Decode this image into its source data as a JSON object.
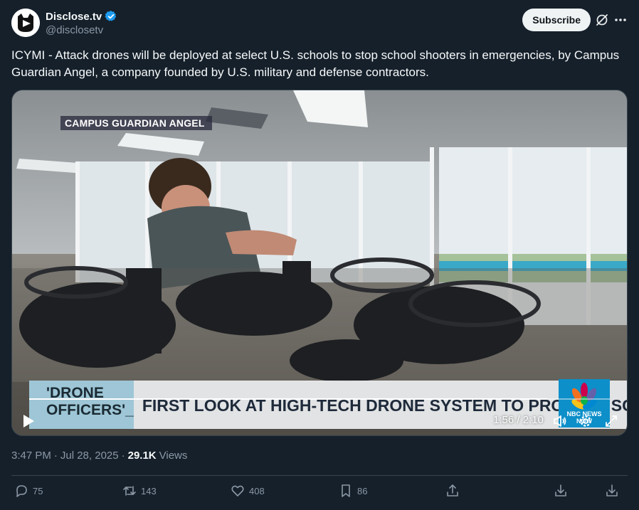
{
  "author": {
    "display_name": "Disclose.tv",
    "handle": "@disclosetv"
  },
  "header": {
    "subscribe_label": "Subscribe"
  },
  "tweet": {
    "text": "ICYMI - Attack drones will be deployed at select U.S. schools to stop school shooters in emergencies, by Campus Guardian Angel, a company founded by U.S. military and defense contractors."
  },
  "video": {
    "chyron_tag": "CAMPUS GUARDIAN ANGEL",
    "lower_third_left_line1": "'DRONE",
    "lower_third_left_line2": "OFFICERS'_",
    "lower_third_headline": "FIRST LOOK AT HIGH-TECH DRONE SYSTEM TO PROTECT SCHOOLS",
    "network_logo_text": "NBC NEWS NOW",
    "current_time": "1:56",
    "duration": "2:10",
    "time_display": "1:56 / 2:10",
    "progress_fraction": 0.892
  },
  "meta": {
    "time": "3:47 PM",
    "date": "Jul 28, 2025",
    "separator": "·",
    "views_count": "29.1K",
    "views_label": "Views"
  },
  "actions": {
    "replies": "75",
    "reposts": "143",
    "likes": "408",
    "bookmarks": "86"
  },
  "colors": {
    "background": "#15202b",
    "accent_verified": "#1d9bf0",
    "muted_text": "#8b98a5"
  },
  "icons": [
    "verified-badge-icon",
    "grok-icon",
    "more-icon",
    "play-icon",
    "volume-icon",
    "settings-icon",
    "fullscreen-icon",
    "reply-icon",
    "repost-icon",
    "like-icon",
    "bookmark-icon",
    "share-icon",
    "download-icon"
  ]
}
